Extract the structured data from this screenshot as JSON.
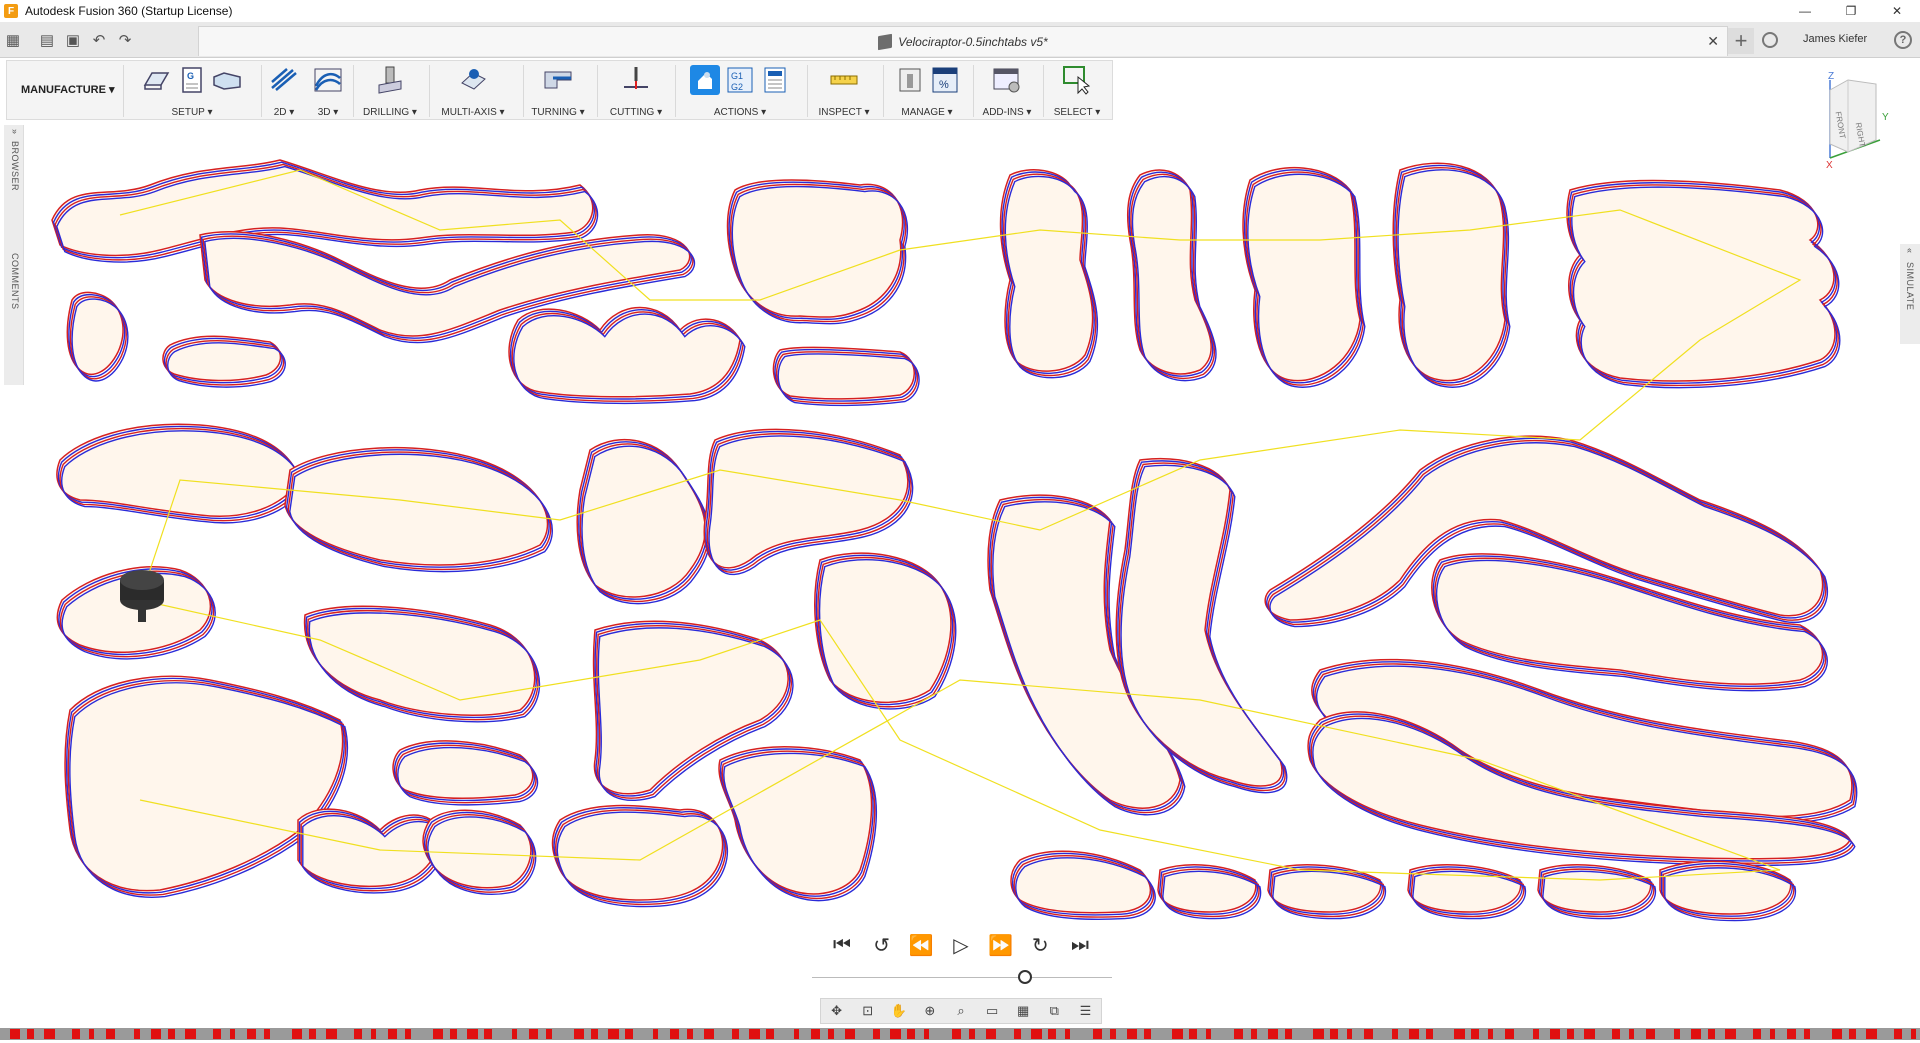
{
  "window": {
    "title": "Autodesk Fusion 360 (Startup License)",
    "logo_letter": "F",
    "minimize": "—",
    "restore": "❐",
    "close": "✕"
  },
  "tabbar": {
    "document_title": "Velociraptor-0.5inchtabs v5*",
    "close_glyph": "✕",
    "new_tab_glyph": "+",
    "user": "James Kiefer",
    "help_glyph": "?"
  },
  "toolbar": {
    "workspace": "MANUFACTURE",
    "groups": [
      {
        "label": "SETUP"
      },
      {
        "label": "2D"
      },
      {
        "label": "3D"
      },
      {
        "label": "DRILLING"
      },
      {
        "label": "MULTI-AXIS"
      },
      {
        "label": "TURNING"
      },
      {
        "label": "CUTTING"
      },
      {
        "label": "ACTIONS"
      },
      {
        "label": "INSPECT"
      },
      {
        "label": "MANAGE"
      },
      {
        "label": "ADD-INS"
      },
      {
        "label": "SELECT"
      }
    ]
  },
  "panels": {
    "browser": "BROWSER",
    "comments": "COMMENTS",
    "simulate": "SIMULATE"
  },
  "viewcube": {
    "front": "FRONT",
    "right": "RIGHT",
    "axis_z": "Z",
    "axis_y": "Y",
    "axis_x": "X"
  },
  "playback": {
    "buttons": [
      "first",
      "prev-operation",
      "rewind",
      "play",
      "fast-forward",
      "next-operation",
      "last"
    ],
    "slider_position": 0.71
  },
  "colors": {
    "part_fill": "#fff6ec",
    "toolpath_blue": "#2a2ad8",
    "toolpath_red": "#d62020",
    "rapid_yellow": "#f0e020",
    "timeline_marker": "#e01010"
  }
}
